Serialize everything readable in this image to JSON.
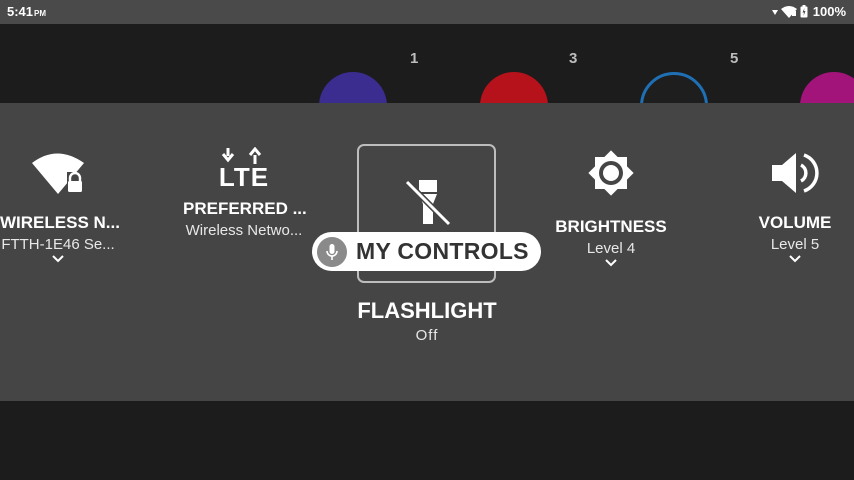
{
  "status_bar": {
    "time": "5:41",
    "am_pm": "PM",
    "battery": "100%"
  },
  "background": {
    "badges": [
      "1",
      "3",
      "5"
    ],
    "colors": {
      "purple": "#3a2d8f",
      "red": "#b5121b",
      "blue": "#1e6fb3",
      "magenta": "#a3147a"
    }
  },
  "tiles": [
    {
      "title": "WIRELESS N...",
      "subtitle": "FTTH-1E46 Se...",
      "icon": "wifi-lock-icon"
    },
    {
      "title": "PREFERRED ...",
      "subtitle": "Wireless Netwo...",
      "icon": "lte-icon"
    },
    {
      "title": "FLASHLIGHT",
      "subtitle": "Off",
      "icon": "flashlight-off-icon"
    },
    {
      "title": "BRIGHTNESS",
      "subtitle": "Level 4",
      "icon": "brightness-icon"
    },
    {
      "title": "VOLUME",
      "subtitle": "Level 5",
      "icon": "volume-icon"
    }
  ],
  "lte_label": "LTE",
  "voice_pill": {
    "label": "MY CONTROLS",
    "icon": "microphone-icon"
  },
  "colors": {
    "panel": "#454545",
    "statusbar": "#4a4a4a",
    "screen": "#1c1c1c"
  }
}
